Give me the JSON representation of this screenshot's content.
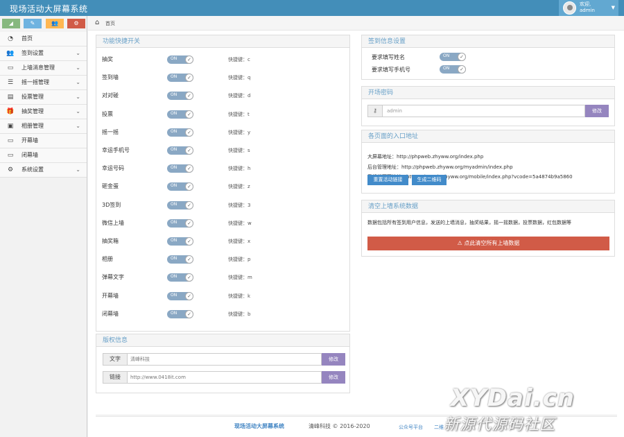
{
  "app": {
    "title": "现场活动大屏幕系统"
  },
  "user": {
    "welcome": "欢迎,",
    "name": "admin"
  },
  "shortcuts": [
    {
      "icon": "signal-icon",
      "glyph": "◢",
      "color": "#87b87f"
    },
    {
      "icon": "pencil-icon",
      "glyph": "✎",
      "color": "#6fb3e0"
    },
    {
      "icon": "users-icon",
      "glyph": "👥",
      "color": "#ffb752"
    },
    {
      "icon": "cogs-icon",
      "glyph": "⚙",
      "color": "#d15b47"
    }
  ],
  "sidebar": {
    "items": [
      {
        "label": "首页",
        "icon": "dashboard-icon",
        "glyph": "◔",
        "chevron": false
      },
      {
        "label": "签到设置",
        "icon": "group-icon",
        "glyph": "👥",
        "chevron": true
      },
      {
        "label": "上墙消息管理",
        "icon": "desktop-icon",
        "glyph": "▭",
        "chevron": true
      },
      {
        "label": "摇一摇管理",
        "icon": "list-icon",
        "glyph": "☰",
        "chevron": true
      },
      {
        "label": "投票管理",
        "icon": "list-alt-icon",
        "glyph": "▤",
        "chevron": true
      },
      {
        "label": "抽奖管理",
        "icon": "gift-icon",
        "glyph": "🎁",
        "chevron": true
      },
      {
        "label": "相册管理",
        "icon": "picture-icon",
        "glyph": "▣",
        "chevron": true
      },
      {
        "label": "开幕墙",
        "icon": "desktop-icon",
        "glyph": "▭",
        "chevron": false
      },
      {
        "label": "闭幕墙",
        "icon": "desktop-icon",
        "glyph": "▭",
        "chevron": false
      },
      {
        "label": "系统设置",
        "icon": "cog-icon",
        "glyph": "⚙",
        "chevron": true
      }
    ]
  },
  "breadcrumb": {
    "home": "首页"
  },
  "functions": {
    "title": "功能快捷开关",
    "toggle_on": "ON",
    "hotkey_prefix": "快捷键：",
    "items": [
      {
        "name": "抽奖",
        "key": "c"
      },
      {
        "name": "签到墙",
        "key": "q"
      },
      {
        "name": "对对碰",
        "key": "d"
      },
      {
        "name": "投票",
        "key": "t"
      },
      {
        "name": "摇一摇",
        "key": "y"
      },
      {
        "name": "幸运手机号",
        "key": "s"
      },
      {
        "name": "幸运号码",
        "key": "h"
      },
      {
        "name": "砸金蛋",
        "key": "z"
      },
      {
        "name": "3D签到",
        "key": "3"
      },
      {
        "name": "微信上墙",
        "key": "w"
      },
      {
        "name": "抽奖箱",
        "key": "x"
      },
      {
        "name": "相册",
        "key": "p"
      },
      {
        "name": "弹幕文字",
        "key": "m"
      },
      {
        "name": "开幕墙",
        "key": "k"
      },
      {
        "name": "闭幕墙",
        "key": "b"
      }
    ]
  },
  "copyright": {
    "title": "版权信息",
    "text_label": "文字",
    "text_value": "清峰科技",
    "link_label": "链接",
    "link_value": "http://www.0418it.com",
    "modify": "修改"
  },
  "signin": {
    "title": "签到信息设置",
    "toggle_on": "ON",
    "items": [
      {
        "name": "要求填写姓名"
      },
      {
        "name": "要求填写手机号"
      }
    ]
  },
  "password": {
    "title": "开场密码",
    "value": "admin",
    "modify": "修改"
  },
  "entries": {
    "title": "各页面的入口地址",
    "lines": [
      "大屏幕地址：http://phpweb.zhyww.org/index.php",
      "后台管理地址：http://phpweb.zhyww.org/myadmin/index.php",
      "手机端页面地址：http://phpweb.zhyww.org/mobile/index.php?vcode=5a4874b9a5860"
    ],
    "reset_btn": "重置活动链接",
    "qr_btn": "生成二维码"
  },
  "clear": {
    "title": "清空上墙系统数据",
    "desc": "数据包括所有签到用户信息，发送的上墙消息，抽奖结果，摇一摇数据，投票数据，红包数据等",
    "button": "点此清空所有上墙数据"
  },
  "footer": {
    "brand": "现场活动大屏幕系统",
    "copyright": "清峰科技 © 2016-2020",
    "link1": "公众号平台",
    "link2": "二维"
  },
  "watermark": {
    "line1": "XYDai.cn",
    "line2": "新源代源码社区"
  }
}
